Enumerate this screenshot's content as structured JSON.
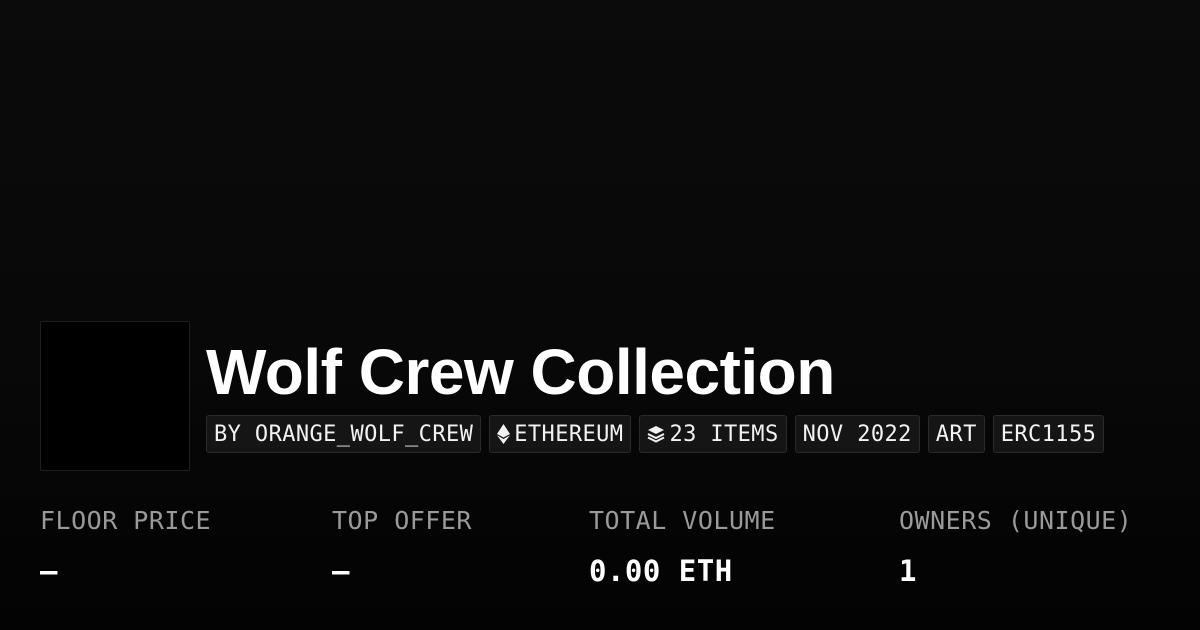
{
  "collection": {
    "title": "Wolf Crew Collection"
  },
  "chips": {
    "creator": "BY ORANGE_WOLF_CREW",
    "chain": "ETHEREUM",
    "chain_icon": "ethereum-icon",
    "items": "23 ITEMS",
    "items_icon": "layers-icon",
    "date": "NOV 2022",
    "category": "ART",
    "standard": "ERC1155"
  },
  "stats": {
    "floor_price": {
      "label": "FLOOR PRICE",
      "value": "—"
    },
    "top_offer": {
      "label": "TOP OFFER",
      "value": "—"
    },
    "total_volume": {
      "label": "TOTAL VOLUME",
      "value": "0.00 ETH"
    },
    "owners": {
      "label": "OWNERS (UNIQUE)",
      "value": "1"
    }
  },
  "colors": {
    "background": "#0b0b0b",
    "chip_background": "#151515",
    "chip_border": "#2a2a2a",
    "label_gray": "#9a9a9a",
    "text": "#ffffff"
  }
}
